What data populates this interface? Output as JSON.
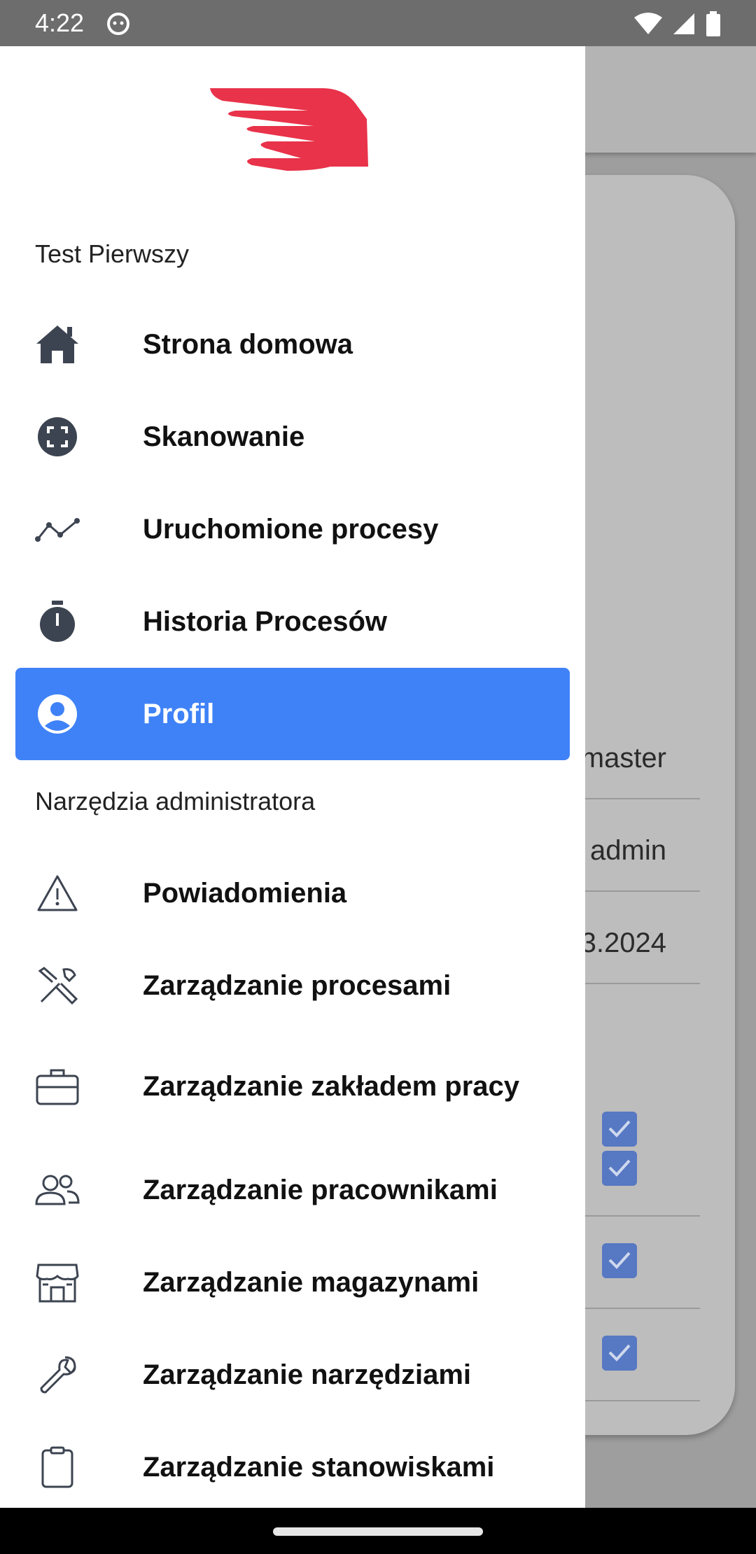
{
  "status_bar": {
    "time": "4:22"
  },
  "background": {
    "rows": [
      "master",
      "admin",
      "3.2024"
    ]
  },
  "drawer": {
    "user_name": "Test Pierwszy",
    "admin_section_label": "Narzędzia administratora",
    "items": [
      {
        "label": "Strona domowa",
        "icon": "home-icon"
      },
      {
        "label": "Skanowanie",
        "icon": "scan-icon"
      },
      {
        "label": "Uruchomione procesy",
        "icon": "chart-line-icon"
      },
      {
        "label": "Historia Procesów",
        "icon": "stopwatch-icon"
      },
      {
        "label": "Profil",
        "icon": "user-circle-icon",
        "active": true
      }
    ],
    "admin_items": [
      {
        "label": "Powiadomienia",
        "icon": "warning-icon"
      },
      {
        "label": "Zarządzanie procesami",
        "icon": "tools-icon"
      },
      {
        "label": "Zarządzanie zakładem pracy",
        "icon": "briefcase-icon"
      },
      {
        "label": "Zarządzanie pracownikami",
        "icon": "users-icon"
      },
      {
        "label": "Zarządzanie magazynami",
        "icon": "store-icon"
      },
      {
        "label": "Zarządzanie narzędziami",
        "icon": "wrench-icon"
      },
      {
        "label": "Zarządzanie stanowiskami",
        "icon": "clipboard-icon"
      }
    ]
  },
  "colors": {
    "accent": "#3f82f7",
    "logo": "#e8334a"
  }
}
